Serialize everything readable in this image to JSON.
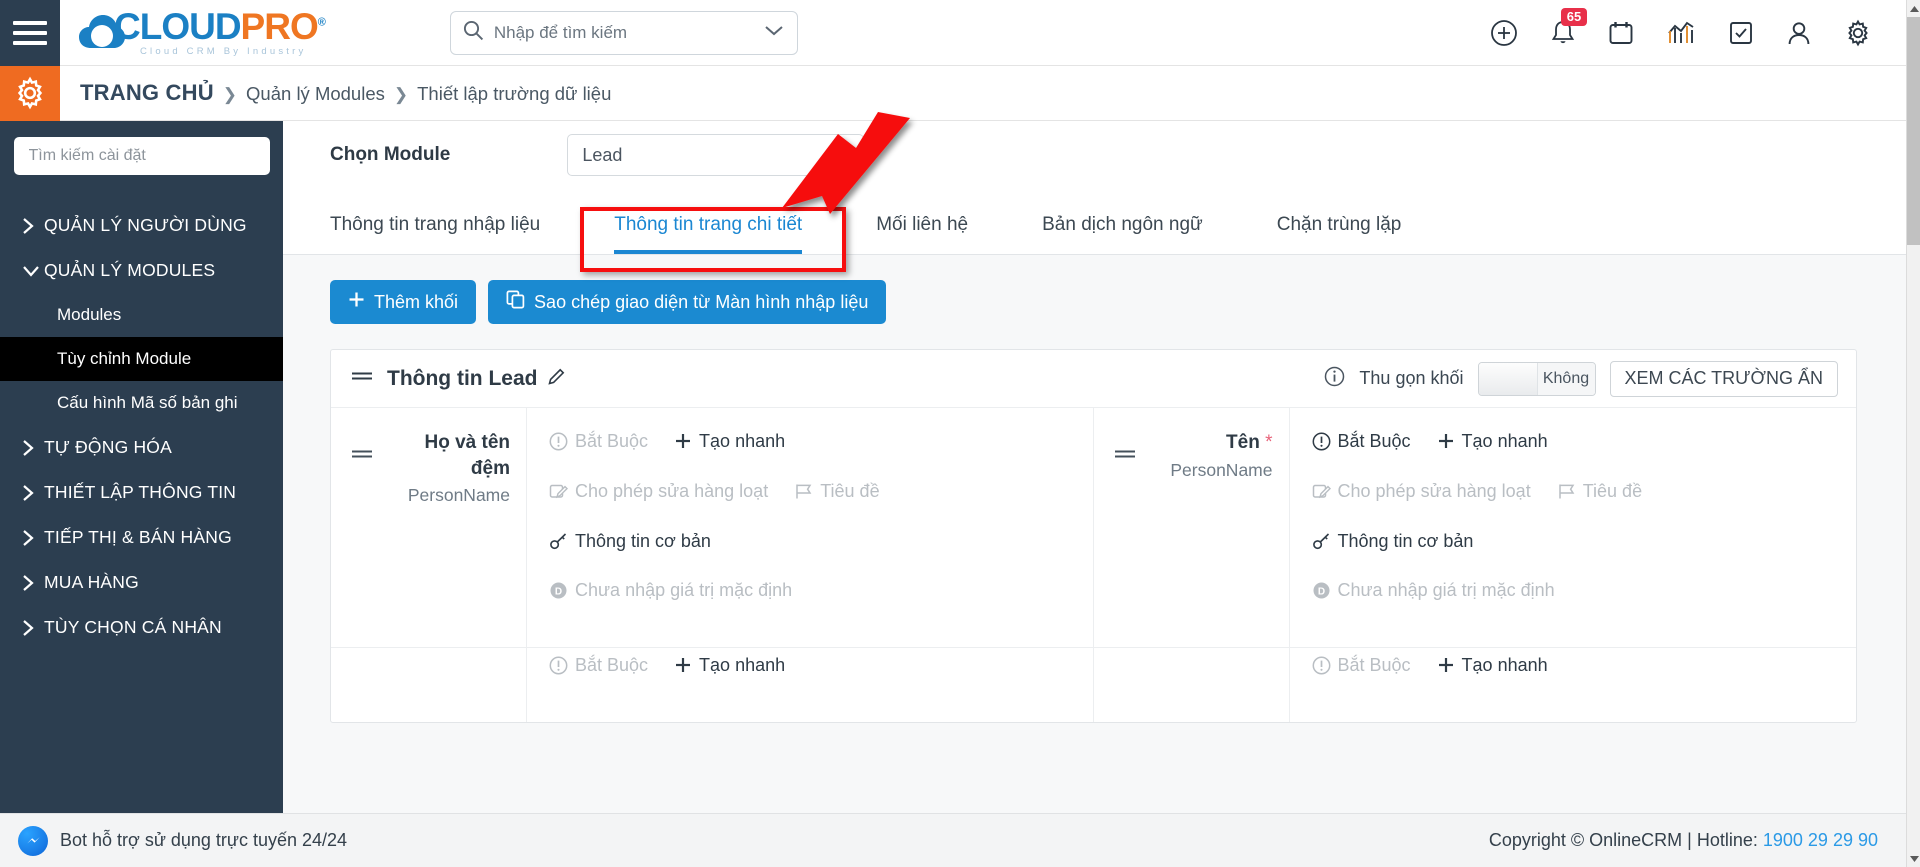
{
  "header": {
    "menu_icon": "hamburger-icon",
    "logo": {
      "part1": "CLOUD",
      "part2": "PRO",
      "reg": "®",
      "tagline": "Cloud CRM By Industry"
    },
    "search": {
      "placeholder": "Nhập để tìm kiếm",
      "value": ""
    },
    "icons": [
      {
        "name": "add-circle-icon",
        "label": ""
      },
      {
        "name": "bell-icon",
        "label": "",
        "badge": "65"
      },
      {
        "name": "calendar-icon",
        "label": ""
      },
      {
        "name": "analytics-icon",
        "label": ""
      },
      {
        "name": "task-check-icon",
        "label": ""
      },
      {
        "name": "user-icon",
        "label": ""
      },
      {
        "name": "gear-icon",
        "label": ""
      }
    ],
    "notification_count": "65"
  },
  "breadcrumb": {
    "gear_icon": "settings-gear-icon",
    "home": "TRANG CHỦ",
    "separator": "❯",
    "items": [
      "Quản lý Modules",
      "Thiết lập trường dữ liệu"
    ]
  },
  "sidebar": {
    "search_placeholder": "Tìm kiếm cài đặt",
    "items": [
      {
        "label": "QUẢN LÝ NGƯỜI DÙNG",
        "expanded": false
      },
      {
        "label": "QUẢN LÝ MODULES",
        "expanded": true
      },
      {
        "label": "TỰ ĐỘNG HÓA",
        "expanded": false
      },
      {
        "label": "THIẾT LẬP THÔNG TIN",
        "expanded": false
      },
      {
        "label": "TIẾP THỊ & BÁN HÀNG",
        "expanded": false
      },
      {
        "label": "MUA HÀNG",
        "expanded": false
      },
      {
        "label": "TÙY CHỌN CÁ NHÂN",
        "expanded": false
      }
    ],
    "sub_items": [
      {
        "label": "Modules",
        "active": false
      },
      {
        "label": "Tùy chỉnh Module",
        "active": true
      },
      {
        "label": "Cấu hình Mã số bản ghi",
        "active": false
      }
    ]
  },
  "main": {
    "module_label": "Chọn Module",
    "module_value": "Lead",
    "tabs": [
      {
        "label": "Thông tin trang nhập liệu",
        "active": false
      },
      {
        "label": "Thông tin trang chi tiết",
        "active": true
      },
      {
        "label": "Mối liên hệ",
        "active": false
      },
      {
        "label": "Bản dịch ngôn ngữ",
        "active": false
      },
      {
        "label": "Chặn trùng lặp",
        "active": false
      }
    ],
    "buttons": {
      "add_block": "Thêm khối",
      "add_block_icon": "plus-icon",
      "copy_layout": "Sao chép giao diện từ Màn hình nhập liệu",
      "copy_layout_icon": "copy-icon"
    },
    "block": {
      "drag_icon": "drag-handle-icon",
      "title": "Thông tin Lead",
      "edit_icon": "pencil-edit-icon",
      "info_icon": "info-circle-icon",
      "collapse_label": "Thu gọn khối",
      "toggle_value": "Không",
      "hidden_fields_button": "XEM CÁC TRƯỜNG ẨN"
    },
    "fields": [
      {
        "label": "Họ và tên đệm",
        "required_mark": "",
        "api_name": "PersonName",
        "options": {
          "required": {
            "label": "Bắt Buộc",
            "icon": "exclamation-circle-icon",
            "on": false
          },
          "quick_create": {
            "label": "Tạo nhanh",
            "icon": "plus-icon",
            "on": true
          },
          "mass_edit": {
            "label": "Cho phép sửa hàng loạt",
            "icon": "mass-edit-icon",
            "on": false
          },
          "headline": {
            "label": "Tiêu đề",
            "icon": "flag-icon",
            "on": false
          },
          "basic_info": {
            "label": "Thông tin cơ bản",
            "icon": "key-icon",
            "on": true
          },
          "default_value": {
            "label": "Chưa nhập giá trị mặc định",
            "icon": "default-value-icon",
            "on": false
          }
        }
      },
      {
        "label": "Tên",
        "required_mark": "*",
        "api_name": "PersonName",
        "options": {
          "required": {
            "label": "Bắt Buộc",
            "icon": "exclamation-circle-icon",
            "on": true
          },
          "quick_create": {
            "label": "Tạo nhanh",
            "icon": "plus-icon",
            "on": true
          },
          "mass_edit": {
            "label": "Cho phép sửa hàng loạt",
            "icon": "mass-edit-icon",
            "on": false
          },
          "headline": {
            "label": "Tiêu đề",
            "icon": "flag-icon",
            "on": false
          },
          "basic_info": {
            "label": "Thông tin cơ bản",
            "icon": "key-icon",
            "on": true
          },
          "default_value": {
            "label": "Chưa nhập giá trị mặc định",
            "icon": "default-value-icon",
            "on": false
          }
        }
      }
    ],
    "partial_row": {
      "required": "Bắt Buộc",
      "quick_create": "Tạo nhanh"
    }
  },
  "footer": {
    "bot_icon": "messenger-icon",
    "bot_text": "Bot hỗ trợ sử dụng trực tuyến 24/24",
    "copyright": "Copyright © OnlineCRM | Hotline: ",
    "hotline": "1900 29 29 90"
  },
  "colors": {
    "sidebar_bg": "#2c3e50",
    "accent_orange": "#ef6b21",
    "accent_blue": "#1b8ad1",
    "annotation_red": "#f60f0f",
    "badge_red": "#e8304a"
  }
}
